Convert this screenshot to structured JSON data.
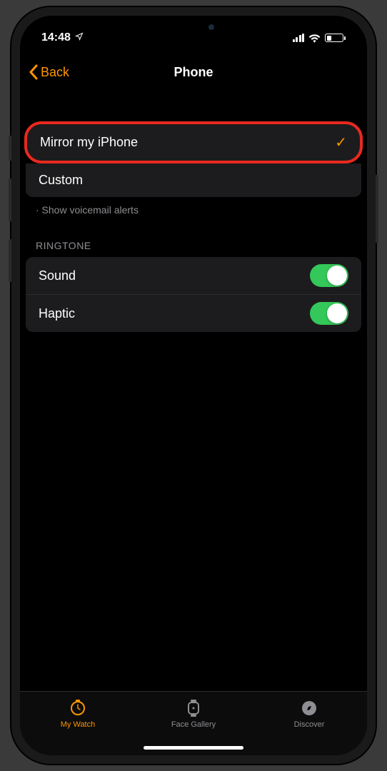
{
  "status": {
    "time": "14:48"
  },
  "nav": {
    "back_label": "Back",
    "title": "Phone"
  },
  "alerts": {
    "options": [
      {
        "label": "Mirror my iPhone",
        "selected": true,
        "highlighted": true
      },
      {
        "label": "Custom",
        "selected": false,
        "highlighted": false
      }
    ],
    "footer": "· Show voicemail alerts"
  },
  "ringtone": {
    "header": "RINGTONE",
    "rows": [
      {
        "label": "Sound",
        "on": true
      },
      {
        "label": "Haptic",
        "on": true
      }
    ]
  },
  "tabs": [
    {
      "label": "My Watch",
      "active": true
    },
    {
      "label": "Face Gallery",
      "active": false
    },
    {
      "label": "Discover",
      "active": false
    }
  ]
}
